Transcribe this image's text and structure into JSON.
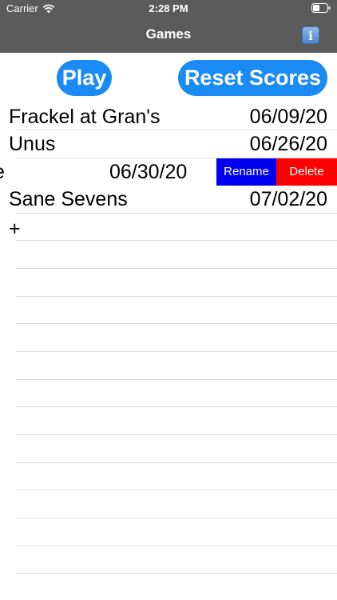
{
  "status_bar": {
    "carrier": "Carrier",
    "time": "2:28 PM",
    "wifi_icon": "wifi-icon",
    "battery_icon": "battery-icon"
  },
  "nav": {
    "title": "Games",
    "info_icon": "info-icon",
    "info_label": "i"
  },
  "buttons": {
    "play_label": "Play",
    "reset_label": "Reset Scores",
    "accent_color": "#1a8af5"
  },
  "games": [
    {
      "name": "Frackel at Gran's",
      "date": "06/09/20"
    },
    {
      "name": "Unus",
      "date": "06/26/20"
    },
    {
      "name": "e",
      "date": "06/30/20",
      "swiped": true
    },
    {
      "name": "Sane Sevens",
      "date": "07/02/20"
    }
  ],
  "swipe_actions": {
    "rename_label": "Rename",
    "delete_label": "Delete",
    "rename_color": "#0000ee",
    "delete_color": "#ff0000"
  },
  "add_label": "+"
}
